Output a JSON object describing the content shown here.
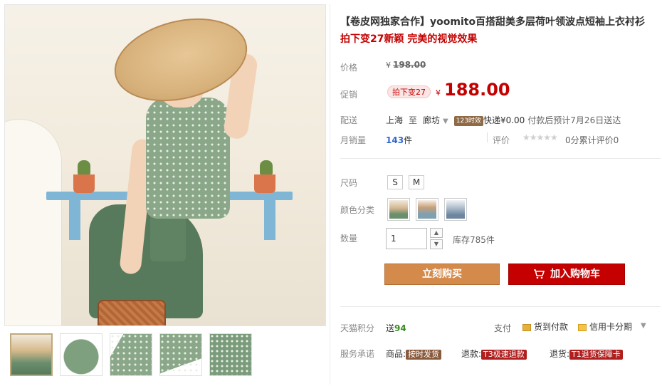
{
  "product": {
    "title_line1": "【卷皮网独家合作】yoomito百搭甜美多层荷叶领波点短袖上衣衬衫",
    "title_line2": "拍下变27新颖 完美的视觉效果"
  },
  "price": {
    "label": "价格",
    "yen": "¥",
    "original": "198.00"
  },
  "promo": {
    "label": "促销",
    "badge": "拍下变27",
    "yen": "¥",
    "price": "188.00"
  },
  "shipping": {
    "label": "配送",
    "from": "上海",
    "to_word": "至",
    "to": "廊坊",
    "caret": "▼",
    "tag": "123时效",
    "express": "快递¥0.00",
    "note": "付款后预计7月26日送达"
  },
  "sales": {
    "label": "月销量",
    "count": "143",
    "unit": "件",
    "review_label": "评价",
    "stars": "★★★★★",
    "review_count": "0分累计评价0"
  },
  "options": {
    "size_label": "尺码",
    "sizes": [
      "S",
      "M"
    ],
    "color_label": "颜色分类",
    "qty_label": "数量",
    "qty_value": "1",
    "up": "▲",
    "down": "▼",
    "stock": "库存785件"
  },
  "actions": {
    "buy": "立刻购买",
    "cart": "加入购物车"
  },
  "bottom": {
    "points_label": "天猫积分",
    "points_prefix": "送",
    "points_value": "94",
    "pay_label": "支付",
    "pay_cod": "货到付款",
    "pay_credit": "信用卡分期",
    "caret": "▼",
    "service_label": "服务承诺",
    "svc1_prefix": "商品:",
    "svc1_badge": "按时发货",
    "svc2_prefix": "退款:",
    "svc2_badge": "T3极速退款",
    "svc3_prefix": "退货:",
    "svc3_badge": "T1退货保障卡"
  },
  "colors": {
    "accent_red": "#c40000",
    "buy_orange": "#d48a4a",
    "points_green": "#3a8a24"
  },
  "icons": [
    "cart-icon",
    "cod-icon",
    "credit-card-icon",
    "star-icon"
  ]
}
